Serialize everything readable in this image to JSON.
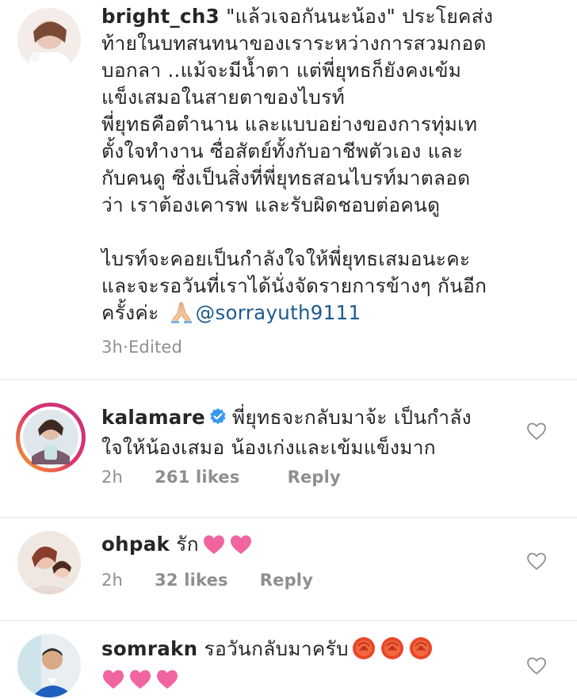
{
  "caption": {
    "username": "bright_ch3",
    "lines": [
      " \"แล้วเจอกันนะน้อง\" ประโยคส่ง",
      "ท้ายในบทสนทนาของเราระหว่างการสวมกอด",
      "บอกลา ..แม้จะมีน้ำตา แต่พี่ยุทธก็ยังคงเข้ม",
      "แข็งเสมอในสายตาของไบรท์",
      "พี่ยุทธคือตำนาน และแบบอย่างของการทุ่มเท",
      "ตั้งใจทำงาน ซื่อสัตย์ทั้งกับอาชีพตัวเอง และ",
      "กับคนดู ซึ่งเป็นสิ่งที่พี่ยุทธสอนไบรท์มาตลอด",
      "ว่า เราต้องเคารพ และรับผิดชอบต่อคนดู"
    ],
    "lines2": [
      "ไบรท์จะคอยเป็นกำลังใจให้พี่ยุทธเสมอนะคะ",
      "และจะรอวันที่เราได้นั่งจัดรายการข้างๆ กันอีก"
    ],
    "last_line_prefix": "ครั้งค่ะ ",
    "mention": "@sorrayuth9111",
    "time": "3h",
    "separator": " · ",
    "edited": "Edited",
    "pray_icon": "folded-hands-emoji"
  },
  "comments": [
    {
      "username": "kalamare",
      "verified": true,
      "line1": "พี่ยุทธจะกลับมาจ้ะ เป็นกำลัง",
      "line2": "ใจให้น้องเสมอ น้องเก่งและเข้มแข็งมาก",
      "time": "2h",
      "likes": "261 likes",
      "reply": "Reply"
    },
    {
      "username": "ohpak",
      "text": "รัก",
      "time": "2h",
      "likes": "32 likes",
      "reply": "Reply",
      "emoji": [
        "pink-heart-emoji",
        "pink-heart-emoji"
      ]
    },
    {
      "username": "somrakn",
      "text": "รอวันกลับมาครับ",
      "emoji_line1": [
        "rose-emoji",
        "rose-emoji",
        "rose-emoji"
      ],
      "emoji_line2": [
        "pink-heart-emoji",
        "pink-heart-emoji",
        "pink-heart-emoji"
      ]
    }
  ],
  "colors": {
    "text": "#262626",
    "meta": "#8e8e8e",
    "mention": "#1c5b8f",
    "verified": "#3897f0",
    "heart": "#f0659f",
    "story_ring_start": "#f5a623",
    "story_ring_end": "#c13584"
  }
}
